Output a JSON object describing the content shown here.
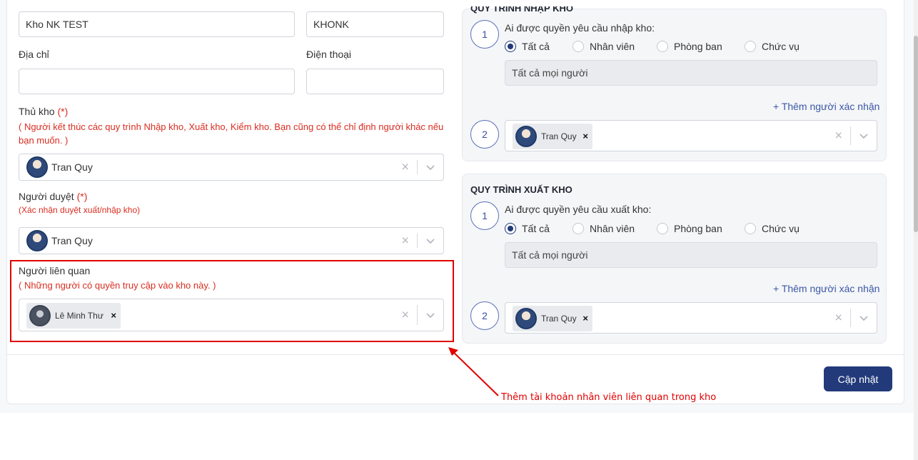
{
  "form": {
    "warehouse_name_value": "Kho NK TEST",
    "warehouse_code_value": "KHONK",
    "address_label": "Địa chỉ",
    "address_value": "",
    "phone_label": "Điện thoại",
    "phone_value": "",
    "keeper_label": "Thủ kho",
    "required_mark": "(*)",
    "keeper_hint": "( Người kết thúc các quy trình Nhập kho, Xuất kho, Kiểm kho. Bạn cũng có thể chỉ định người khác nếu bạn muốn. )",
    "keeper_selected": "Tran Quy",
    "approver_label": "Người duyệt",
    "approver_hint": "(Xác nhận duyệt xuất/nhập kho)",
    "approver_selected": "Tran Quy",
    "related_label": "Người liên quan",
    "related_hint": "( Những người có quyền truy cập vào kho này. )",
    "related_tag": "Lê Minh Thư"
  },
  "import_process": {
    "title": "QUY TRÌNH NHẬP KHO",
    "step1_number": "1",
    "step1_question": "Ai được quyền yêu cầu nhập kho:",
    "options": [
      "Tất cả",
      "Nhân viên",
      "Phòng ban",
      "Chức vụ"
    ],
    "selected_option": "Tất cả",
    "readonly_value": "Tất cả mọi người",
    "add_confirmer_link": "+ Thêm người xác nhận",
    "step2_number": "2",
    "step2_tag": "Tran Quy"
  },
  "export_process": {
    "title": "QUY TRÌNH XUẤT KHO",
    "step1_number": "1",
    "step1_question": "Ai được quyền yêu cầu xuất kho:",
    "options": [
      "Tất cả",
      "Nhân viên",
      "Phòng ban",
      "Chức vụ"
    ],
    "selected_option": "Tất cả",
    "readonly_value": "Tất cả mọi người",
    "add_confirmer_link": "+ Thêm người xác nhận",
    "step2_number": "2",
    "step2_tag": "Tran Quy"
  },
  "footer": {
    "update_button": "Cập nhật"
  },
  "annotation": {
    "text": "Thêm tài khoản nhân viên liên quan trong kho",
    "color": "#e00000"
  },
  "icons": {
    "clear": "close-icon",
    "dropdown": "chevron-down-icon",
    "tag_remove": "close-icon"
  },
  "colors": {
    "primary": "#223a7a",
    "required": "#d92d20",
    "link": "#3b58a8"
  }
}
